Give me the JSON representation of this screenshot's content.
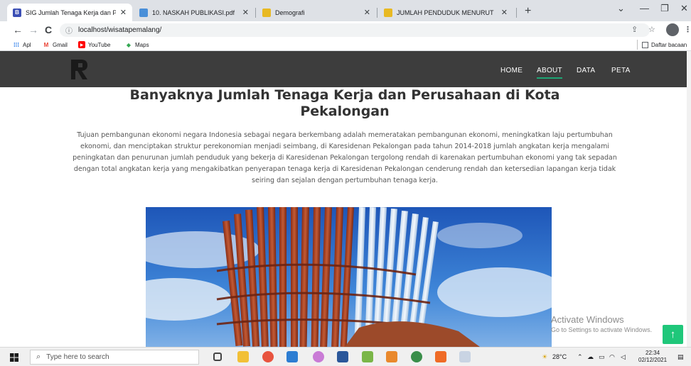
{
  "browser": {
    "tabs": [
      {
        "title": "SIG Jumlah Tenaga Kerja dan Per",
        "icon": "site-b-icon",
        "active": true
      },
      {
        "title": "10. NASKAH PUBLIKASI.pdf",
        "icon": "pdf-file-icon",
        "active": false
      },
      {
        "title": "Demografi",
        "icon": "web-page-icon",
        "active": false
      },
      {
        "title": "JUMLAH PENDUDUK MENURUT",
        "icon": "web-page-icon",
        "active": false
      }
    ],
    "url": "localhost/wisatapemalang/",
    "bookmarks": [
      "Apl",
      "Gmail",
      "YouTube",
      "Maps"
    ],
    "reading_list": "Daftar bacaan"
  },
  "site": {
    "nav": [
      "HOME",
      "ABOUT",
      "DATA",
      "PETA"
    ],
    "active_nav": "ABOUT",
    "title": "Banyaknya Jumlah Tenaga Kerja dan Perusahaan di Kota Pekalongan",
    "paragraph": "Tujuan pembangunan ekonomi negara Indonesia sebagai negara berkembang adalah memeratakan pembangunan ekonomi, meningkatkan laju pertumbuhan ekonomi, dan menciptakan struktur perekonomian menjadi seimbang, di Karesidenan Pekalongan pada tahun 2014-2018 jumlah angkatan kerja mengalami peningkatan dan penurunan jumlah penduduk yang bekerja di Karesidenan Pekalongan tergolong rendah di karenakan pertumbuhan ekonomi yang tak sepadan dengan total angkatan kerja yang mengakibatkan penyerapan tenaga kerja di Karesidenan Pekalongan cenderung rendah dan ketersedian lapangan kerja tidak seiring dan sejalan dengan pertumbuhan tenaga kerja."
  },
  "watermark": {
    "line1": "Activate Windows",
    "line2": "Go to Settings to activate Windows."
  },
  "taskbar": {
    "search_placeholder": "Type here to search",
    "weather": "28°C",
    "time": "22:34",
    "date": "02/12/2021"
  },
  "colors": {
    "nav_bg": "#3d3d3d",
    "accent": "#1ea574",
    "scroll_top_button": "#1fc77a",
    "tabstrip_bg": "#dee1e6"
  }
}
